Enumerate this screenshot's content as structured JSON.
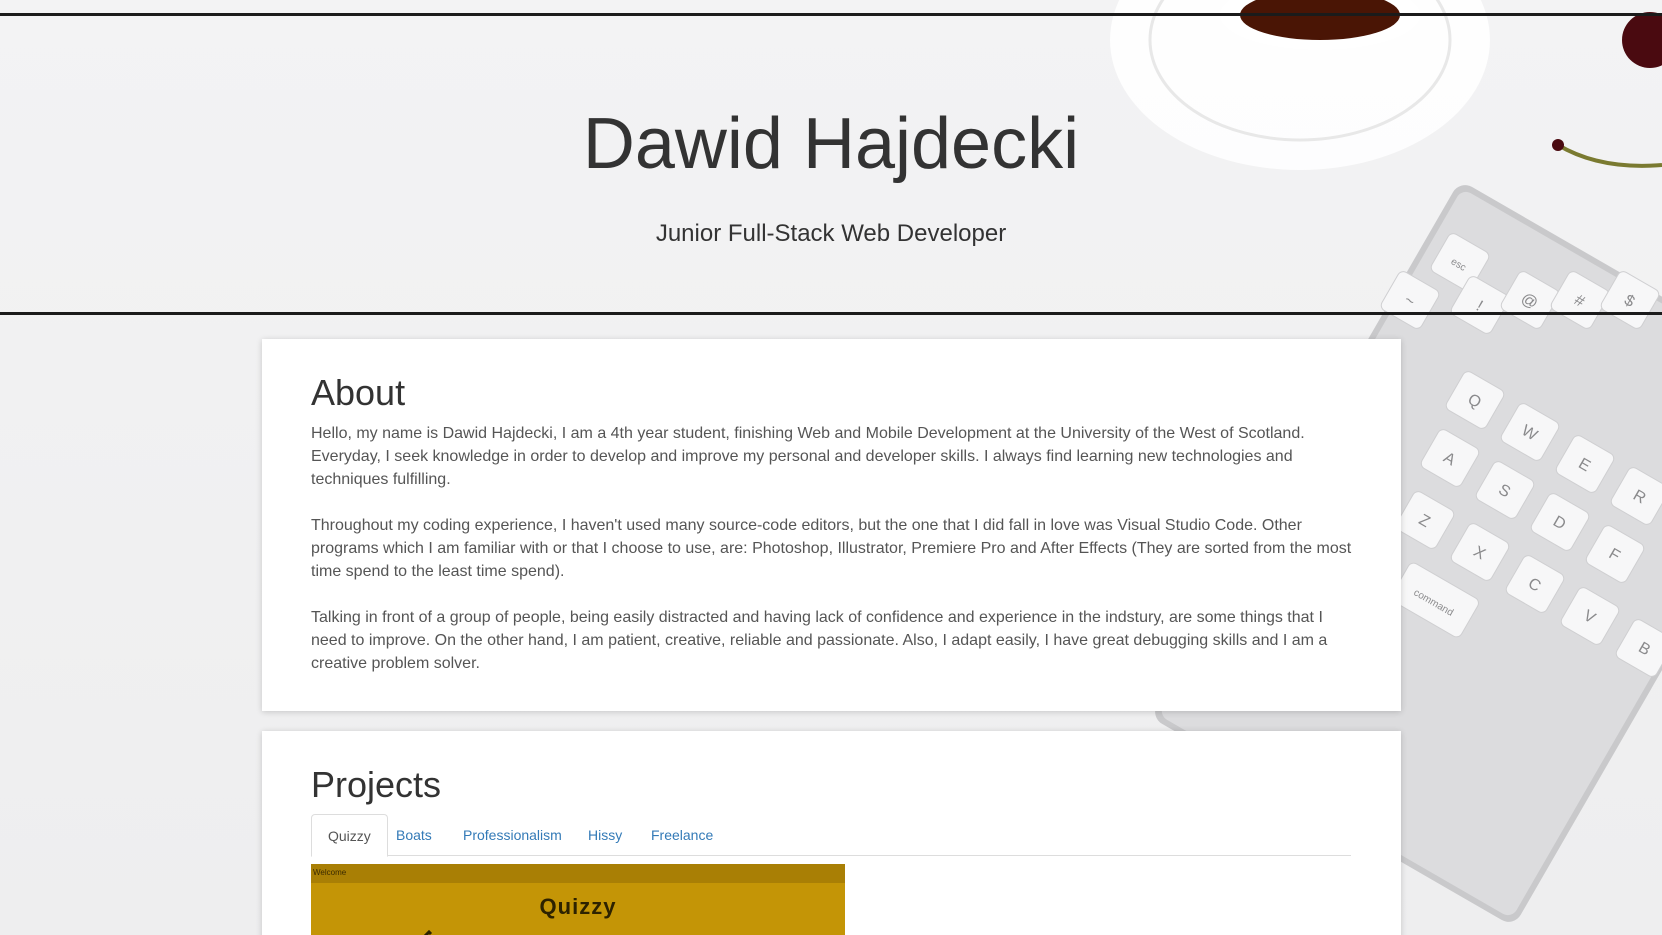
{
  "header": {
    "title": "Dawid Hajdecki",
    "subtitle": "Junior Full-Stack Web Developer"
  },
  "about": {
    "heading": "About",
    "paragraphs": [
      "Hello, my name is Dawid Hajdecki, I am a 4th year student, finishing Web and Mobile Development at the University of the West of Scotland. Everyday, I seek knowledge in order to develop and improve my personal and developer skills. I always find learning new technologies and techniques fulfilling.",
      "Throughout my coding experience, I haven't used many source-code editors, but the one that I did fall in love was Visual Studio Code. Other programs which I am familiar with or that I choose to use, are: Photoshop, Illustrator, Premiere Pro and After Effects (They are sorted from the most time spend to the least time spend).",
      "Talking in front of a group of people, being easily distracted and having lack of confidence and experience in the indstury, are some things that I need to improve. On the other hand, I am patient, creative, reliable and passionate. Also, I adapt easily, I have great debugging skills and I am a creative problem solver."
    ]
  },
  "projects": {
    "heading": "Projects",
    "tabs": [
      {
        "label": "Quizzy",
        "active": true
      },
      {
        "label": "Boats",
        "active": false
      },
      {
        "label": "Professionalism",
        "active": false
      },
      {
        "label": "Hissy",
        "active": false
      },
      {
        "label": "Freelance",
        "active": false
      }
    ],
    "preview": {
      "bar_label": "Welcome",
      "title": "Quizzy"
    }
  },
  "background": {
    "keyboard_keys": [
      "esc",
      "~",
      "!",
      "@",
      "#",
      "$",
      "Q",
      "W",
      "E",
      "R",
      "A",
      "S",
      "D",
      "F",
      "Z",
      "X",
      "C",
      "V",
      "B",
      "command"
    ]
  },
  "colors": {
    "link": "#337ab7",
    "text": "#333333",
    "body_text": "#555555",
    "preview_bg": "#c49506"
  }
}
